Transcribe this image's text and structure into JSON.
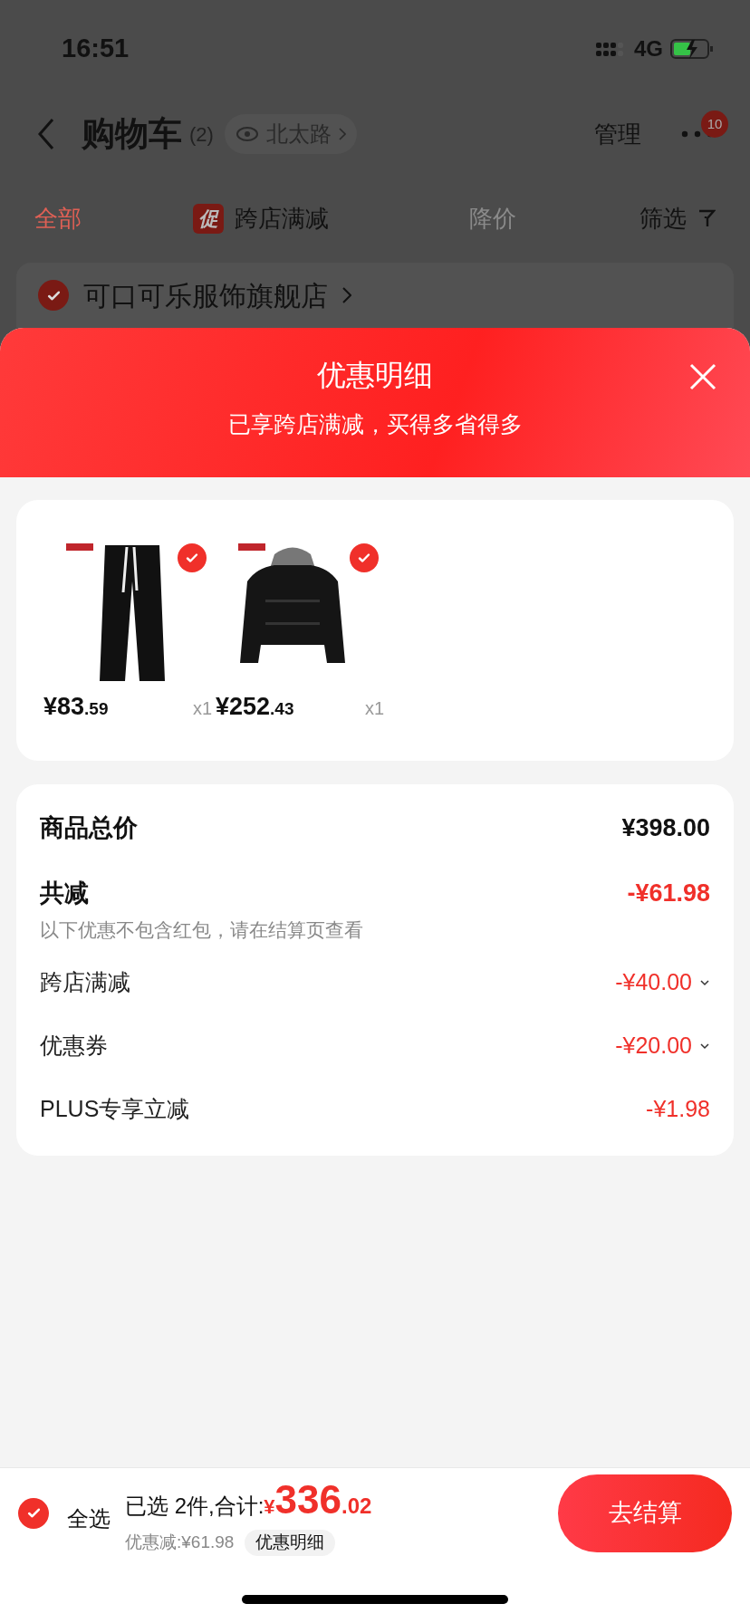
{
  "status_bar": {
    "time": "16:51",
    "network": "4G"
  },
  "nav": {
    "title": "购物车",
    "count": "(2)",
    "location": "北太路",
    "manage": "管理",
    "badge": "10"
  },
  "tabs": [
    {
      "label": "全部",
      "selected": true,
      "disabled": false
    },
    {
      "label": "跨店满减",
      "badge": "促",
      "selected": false,
      "disabled": false
    },
    {
      "label": "降价",
      "selected": false,
      "disabled": true
    }
  ],
  "filter": "筛选",
  "store": {
    "name": "可口可乐服饰旗舰店",
    "checked": true
  },
  "sheet": {
    "title": "优惠明细",
    "subtitle": "已享跨店满减，买得多省得多",
    "products": [
      {
        "kind": "pants",
        "price": "¥83.59",
        "qty": "x1",
        "checked": true
      },
      {
        "kind": "jacket",
        "price": "¥252.43",
        "qty": "x1",
        "checked": true
      }
    ],
    "summary": [
      {
        "kind": "total",
        "label": "商品总价",
        "value": "¥398.00",
        "expandable": false
      },
      {
        "kind": "reduction",
        "label": "共减",
        "value": "-¥61.98",
        "note": "以下优惠不包含红包，请在结算页查看",
        "expandable": false
      },
      {
        "kind": "item",
        "label": "跨店满减",
        "value": "-¥40.00",
        "expandable": true
      },
      {
        "kind": "item",
        "label": "优惠券",
        "value": "-¥20.00",
        "expandable": true
      },
      {
        "kind": "item",
        "label": "PLUS专享立减",
        "value": "-¥1.98",
        "expandable": false
      }
    ]
  },
  "footer": {
    "select_all": "全选",
    "checked": true,
    "selected_text": "已选 2件,合计:",
    "total": "¥336.02",
    "discount": "优惠减:¥61.98",
    "detail_button": "优惠明细",
    "checkout": "去结算"
  }
}
